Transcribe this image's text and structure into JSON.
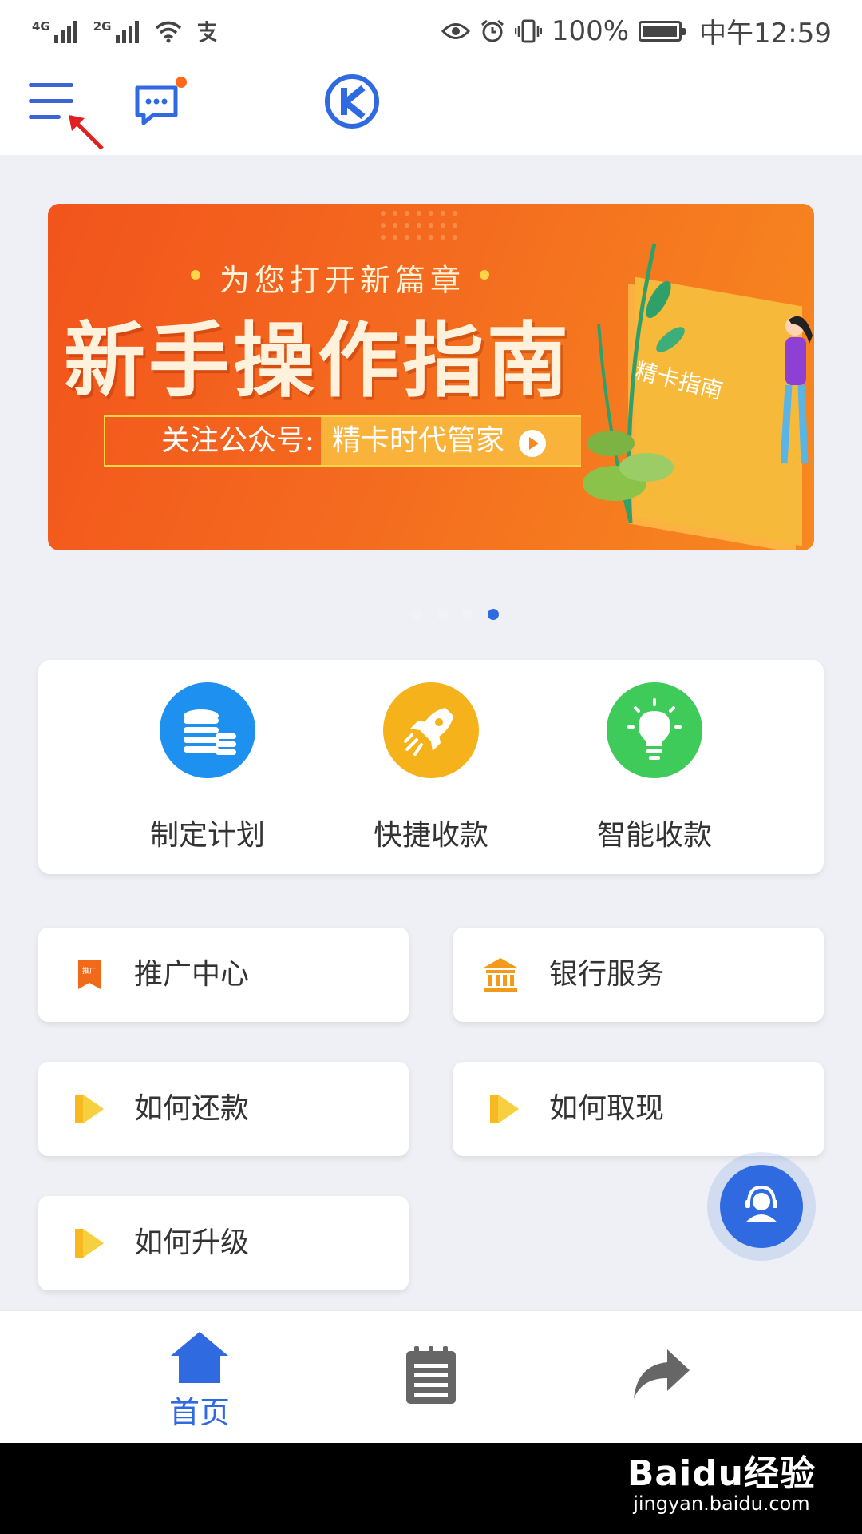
{
  "status_bar": {
    "net1": "4G",
    "net2": "2G",
    "battery_pct": "100%",
    "time": "中午12:59"
  },
  "banner": {
    "subtitle": "为您打开新篇章",
    "title": "新手操作指南",
    "follow_label": "关注公众号:",
    "follow_name": "精卡时代管家",
    "book_label": "精卡指南"
  },
  "carousel": {
    "count": 4,
    "active_index": 4
  },
  "quick_actions": [
    {
      "label": "制定计划",
      "icon": "coins-stack-icon",
      "color": "#1e90f0"
    },
    {
      "label": "快捷收款",
      "icon": "rocket-icon",
      "color": "#f5b21a"
    },
    {
      "label": "智能收款",
      "icon": "lightbulb-icon",
      "color": "#3ecb5a"
    }
  ],
  "links": [
    {
      "label": "推广中心",
      "icon": "promotion-bookmark-icon",
      "badge": "推广"
    },
    {
      "label": "银行服务",
      "icon": "bank-icon"
    },
    {
      "label": "如何还款",
      "icon": "play-icon"
    },
    {
      "label": "如何取现",
      "icon": "play-icon"
    },
    {
      "label": "如何升级",
      "icon": "play-icon"
    }
  ],
  "bottom_nav": [
    {
      "label": "首页",
      "icon": "home-icon",
      "active": true
    },
    {
      "label": "",
      "icon": "notepad-icon",
      "active": false
    },
    {
      "label": "",
      "icon": "share-arrow-icon",
      "active": false
    }
  ],
  "colors": {
    "accent": "#2f6ae0",
    "orange": "#f46a1f",
    "notify_dot": "#ff6a1a"
  },
  "watermark": {
    "logo": "Baidu经验",
    "url": "jingyan.baidu.com"
  }
}
